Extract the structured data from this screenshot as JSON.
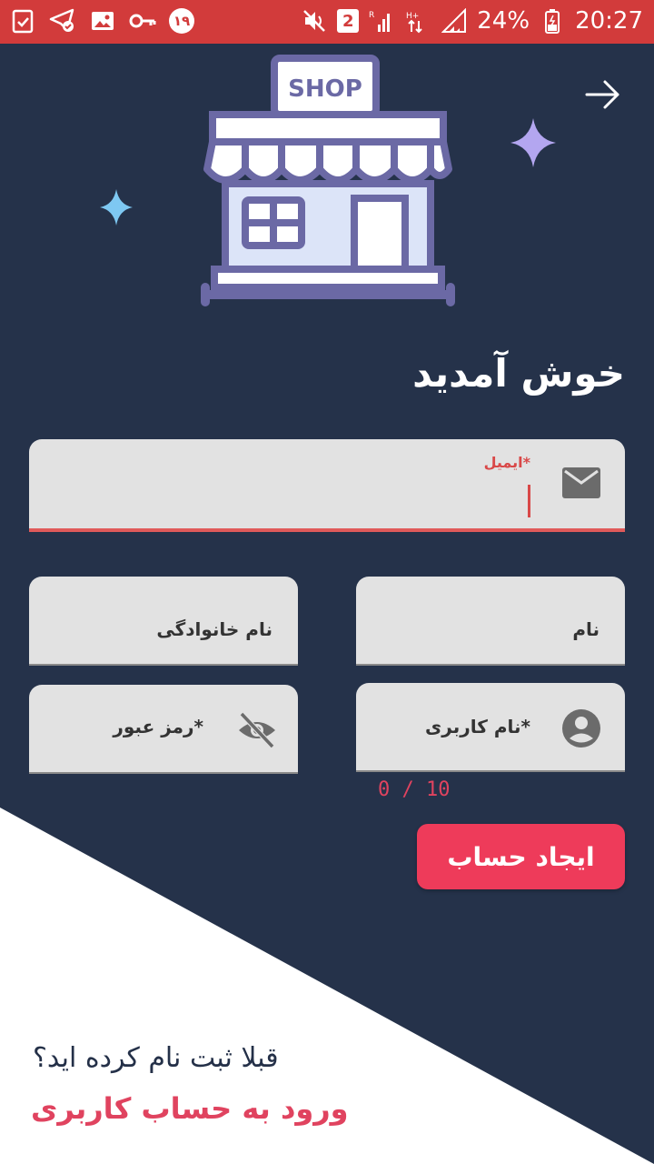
{
  "status_bar": {
    "notification_badge": "2",
    "notification_count": "۱۹",
    "battery": "24%",
    "time": "20:27",
    "icons": [
      "clipboard-check-icon",
      "telegram-check-icon",
      "image-icon",
      "key-icon",
      "mute-icon",
      "signal-icon",
      "battery-icon"
    ]
  },
  "colors": {
    "background_dark": "#25324a",
    "accent": "#ee3b5a",
    "status_bar": "#d23b3b",
    "field_bg": "#e2e2e2"
  },
  "illustration": {
    "sign_text": "SHOP"
  },
  "welcome_title": "خوش آمدید",
  "form": {
    "email": {
      "label": "*ایمیل",
      "value": "",
      "icon": "mail-icon"
    },
    "last_name": {
      "placeholder": "نام خانوادگی",
      "value": ""
    },
    "first_name": {
      "placeholder": "نام",
      "value": ""
    },
    "password": {
      "placeholder": "*رمز عبور",
      "value": "",
      "icon": "eye-off-icon"
    },
    "username": {
      "placeholder": "*نام کاربری",
      "value": "",
      "icon": "account-icon"
    },
    "username_counter": "0 / 10"
  },
  "create_account_button": "ایجاد حساب",
  "already_registered": "قبلا ثبت نام کرده اید؟",
  "login_link": "ورود به حساب کاربری"
}
